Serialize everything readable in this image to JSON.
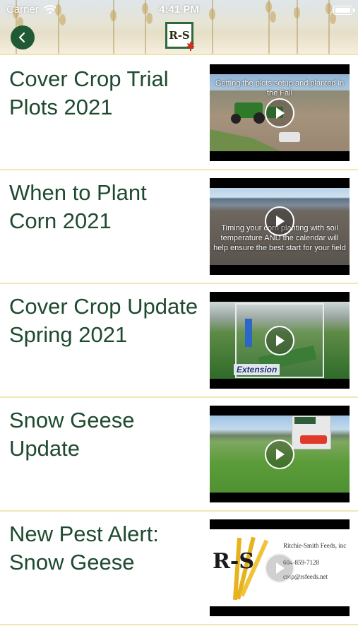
{
  "status_bar": {
    "carrier": "Carrier",
    "time": "4:41 PM"
  },
  "header": {
    "logo_text": "R-S",
    "brand_color": "#1f5a34",
    "back_icon": "chevron-left-icon"
  },
  "videos": [
    {
      "title": "Cover Crop Trial Plots 2021",
      "thumbnail_caption": "Getting the plots setup and planted in the Fall",
      "play_icon": "play-icon"
    },
    {
      "title": "When to Plant Corn 2021",
      "thumbnail_caption": "Timing your corn planting with soil temperature AND the calendar will help ensure the best start for your field",
      "play_icon": "play-icon"
    },
    {
      "title": "Cover Crop Update Spring 2021",
      "thumbnail_caption": "Extension",
      "play_icon": "play-icon"
    },
    {
      "title": "Snow Geese Update",
      "thumbnail_caption": "",
      "play_icon": "play-icon"
    },
    {
      "title": "New Pest Alert: Snow Geese",
      "thumbnail_caption": "",
      "play_icon": "play-icon",
      "card": {
        "logo_text": "R-S",
        "company": "Ritchie-Smith Feeds, inc",
        "phone": "604-859-7128",
        "email": "crop@rsfeeds.net"
      }
    }
  ]
}
